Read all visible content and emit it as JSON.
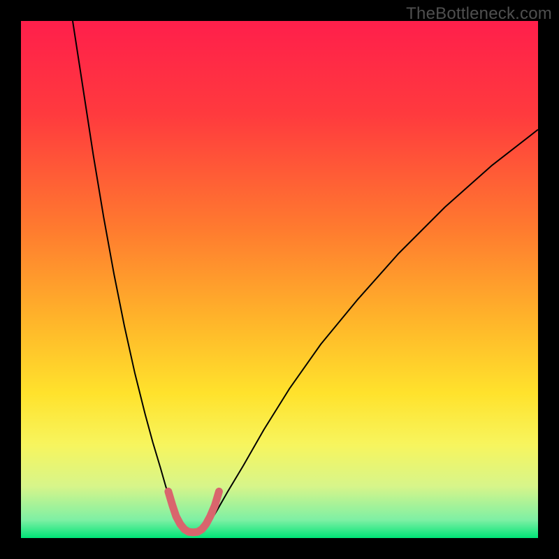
{
  "watermark": "TheBottleneck.com",
  "chart_data": {
    "type": "line",
    "title": "",
    "xlabel": "",
    "ylabel": "",
    "xlim": [
      0,
      100
    ],
    "ylim": [
      0,
      100
    ],
    "grid": false,
    "legend": false,
    "gradient_stops": [
      {
        "offset": 0.0,
        "color": "#ff1f4b"
      },
      {
        "offset": 0.18,
        "color": "#ff3a3e"
      },
      {
        "offset": 0.4,
        "color": "#ff7a2f"
      },
      {
        "offset": 0.58,
        "color": "#ffb52a"
      },
      {
        "offset": 0.72,
        "color": "#ffe22c"
      },
      {
        "offset": 0.82,
        "color": "#f7f55e"
      },
      {
        "offset": 0.9,
        "color": "#d7f58a"
      },
      {
        "offset": 0.965,
        "color": "#7ef0a4"
      },
      {
        "offset": 1.0,
        "color": "#00e477"
      }
    ],
    "series": [
      {
        "name": "left-branch",
        "color": "#000000",
        "width": 2,
        "x": [
          10.0,
          12.0,
          14.0,
          16.0,
          18.0,
          20.0,
          22.0,
          24.0,
          25.5,
          27.0,
          28.0,
          29.0,
          30.0,
          30.8,
          31.5
        ],
        "y": [
          100.0,
          87.0,
          74.0,
          62.0,
          51.0,
          41.0,
          32.0,
          24.0,
          18.5,
          13.5,
          10.0,
          7.0,
          4.5,
          2.8,
          1.6
        ]
      },
      {
        "name": "right-branch",
        "color": "#000000",
        "width": 2,
        "x": [
          35.5,
          36.5,
          38.0,
          40.0,
          43.0,
          47.0,
          52.0,
          58.0,
          65.0,
          73.0,
          82.0,
          91.0,
          100.0
        ],
        "y": [
          1.6,
          3.0,
          5.5,
          9.0,
          14.0,
          21.0,
          29.0,
          37.5,
          46.0,
          55.0,
          64.0,
          72.0,
          79.0
        ]
      },
      {
        "name": "valley-highlight",
        "color": "#d9656d",
        "width": 11,
        "linecap": "round",
        "x": [
          28.5,
          29.3,
          30.0,
          30.8,
          31.6,
          32.4,
          33.3,
          34.2,
          35.0,
          35.8,
          36.6,
          37.5,
          38.3
        ],
        "y": [
          9.0,
          6.3,
          4.2,
          2.7,
          1.7,
          1.2,
          1.1,
          1.2,
          1.7,
          2.7,
          4.2,
          6.3,
          9.0
        ]
      }
    ]
  }
}
